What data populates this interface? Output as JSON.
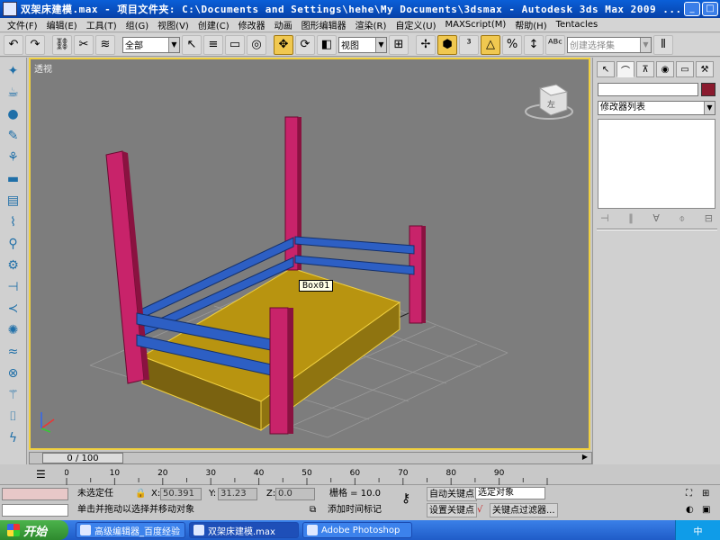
{
  "window": {
    "title": "双架床建模.max  - 项目文件夹: C:\\Documents and Settings\\hehe\\My Documents\\3dsmax  - Autodesk 3ds Max  2009 ..."
  },
  "menu": [
    "文件(F)",
    "编辑(E)",
    "工具(T)",
    "组(G)",
    "视图(V)",
    "创建(C)",
    "修改器",
    "动画",
    "图形编辑器",
    "渲染(R)",
    "自定义(U)",
    "MAXScript(M)",
    "帮助(H)",
    "Tentacles"
  ],
  "toolbar": {
    "selection_filter": "全部",
    "ref_coord": "视图",
    "named_selection_placeholder": "创建选择集"
  },
  "viewport": {
    "label": "透视",
    "object_tooltip": "Box01"
  },
  "command_panel": {
    "modifier_list": "修改器列表"
  },
  "timeline": {
    "frame_display": "0 / 100",
    "ticks": [
      0,
      10,
      20,
      30,
      40,
      50,
      60,
      70,
      80,
      90
    ]
  },
  "status": {
    "selection_status": "未选定任",
    "x_label": "X:",
    "x_value": "50.391",
    "y_label": "Y:",
    "y_value": "31.23",
    "z_label": "Z:",
    "z_value": "0.0",
    "grid": "栅格 = 10.0",
    "prompt": "单击并拖动以选择并移动对象",
    "add_time_tag": "添加时间标记",
    "auto_key": "自动关键点",
    "set_key": "设置关键点",
    "selected_object": "选定对象",
    "key_filters": "关键点过滤器..."
  },
  "taskbar": {
    "start": "开始",
    "tasks": [
      "高级编辑器_百度经验",
      "双架床建模.max",
      "Adobe Photoshop"
    ],
    "tray": "中"
  },
  "colors": {
    "viewport_bg": "#7d7d7d",
    "viewport_border": "#f0d040",
    "post_color": "#c8236a",
    "rail_color": "#2d5fc4",
    "mattress_color": "#b89410"
  }
}
